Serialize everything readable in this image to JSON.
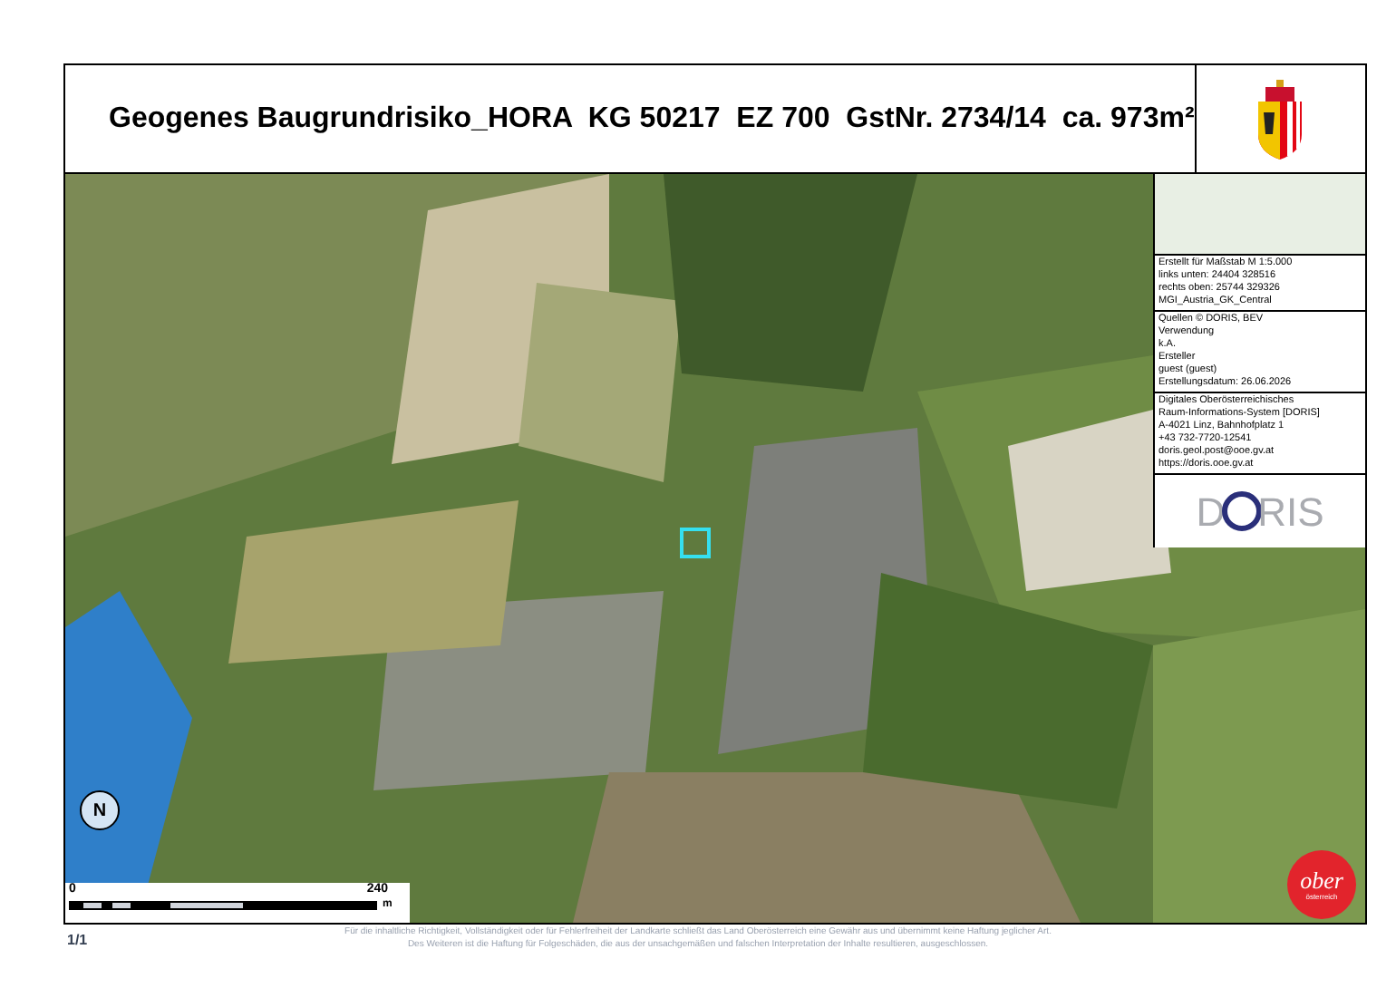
{
  "title": "Geogenes Baugrundrisiko_HORA  KG 50217  EZ 700  GstNr. 2734/14  ca. 973m²",
  "info_blocks": [
    [
      "Erstellt für Maßstab M 1:5.000",
      "links unten: 24404 328516",
      "rechts oben: 25744 329326",
      "MGI_Austria_GK_Central"
    ],
    [
      "Quellen © DORIS, BEV",
      "Verwendung",
      "k.A.",
      "Ersteller",
      "guest (guest)",
      "Erstellungsdatum: 26.06.2026"
    ],
    [
      "Digitales Oberösterreichisches",
      "Raum-Informations-System [DORIS]",
      "A-4021 Linz, Bahnhofplatz 1",
      "+43 732-7720-12541",
      "doris.geol.post@ooe.gv.at",
      "https://doris.ooe.gv.at"
    ]
  ],
  "doris_logo": {
    "left": "D",
    "right": "RIS"
  },
  "north_arrow": {
    "label": "N"
  },
  "scale_bar": {
    "start": "0",
    "end": "240",
    "unit": "m"
  },
  "page": "1/1",
  "disclaimer": [
    "Für die inhaltliche Richtigkeit, Vollständigkeit oder für Fehlerfreiheit der Landkarte schließt das Land Oberösterreich eine Gewähr aus und übernimmt keine Haftung jeglicher Art.",
    "Des Weiteren ist die Haftung für Folgeschäden, die aus der unsachgemäßen und falschen Interpretation der Inhalte resultieren, ausgeschlossen."
  ],
  "region_logo": {
    "top": "ober",
    "bottom": "österreich"
  }
}
